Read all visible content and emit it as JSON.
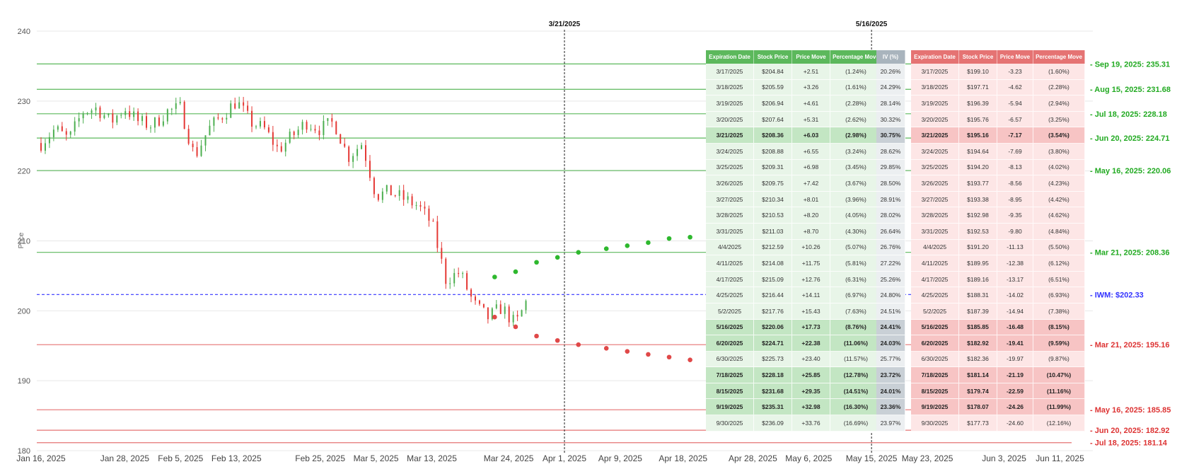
{
  "chart_data": {
    "type": "candlestick",
    "ylabel": "Price",
    "ylim": [
      180,
      240
    ],
    "yticks": [
      "180",
      "190",
      "200",
      "210",
      "220",
      "230",
      "240"
    ],
    "xlim": [
      "2025-01-16",
      "2025-06-15"
    ],
    "xticks": [
      {
        "date": "2025-01-16",
        "label": "Jan 16, 2025"
      },
      {
        "date": "2025-01-28",
        "label": "Jan 28, 2025"
      },
      {
        "date": "2025-02-05",
        "label": "Feb 5, 2025"
      },
      {
        "date": "2025-02-13",
        "label": "Feb 13, 2025"
      },
      {
        "date": "2025-02-25",
        "label": "Feb 25, 2025"
      },
      {
        "date": "2025-03-05",
        "label": "Mar 5, 2025"
      },
      {
        "date": "2025-03-13",
        "label": "Mar 13, 2025"
      },
      {
        "date": "2025-03-24",
        "label": "Mar 24, 2025"
      },
      {
        "date": "2025-04-01",
        "label": "Apr 1, 2025"
      },
      {
        "date": "2025-04-09",
        "label": "Apr 9, 2025"
      },
      {
        "date": "2025-04-18",
        "label": "Apr 18, 2025"
      },
      {
        "date": "2025-04-28",
        "label": "Apr 28, 2025"
      },
      {
        "date": "2025-05-06",
        "label": "May 6, 2025"
      },
      {
        "date": "2025-05-15",
        "label": "May 15, 2025"
      },
      {
        "date": "2025-05-23",
        "label": "May 23, 2025"
      },
      {
        "date": "2025-06-03",
        "label": "Jun 3, 2025"
      },
      {
        "date": "2025-06-11",
        "label": "Jun 11, 2025"
      }
    ],
    "price_path": [
      [
        "2025-01-16",
        224
      ],
      [
        "2025-01-18",
        226
      ],
      [
        "2025-01-20",
        224.5
      ],
      [
        "2025-01-22",
        228.5
      ],
      [
        "2025-01-24",
        229
      ],
      [
        "2025-01-26",
        227
      ],
      [
        "2025-01-28",
        229
      ],
      [
        "2025-01-30",
        227
      ],
      [
        "2025-02-01",
        226.5
      ],
      [
        "2025-02-03",
        228.5
      ],
      [
        "2025-02-05",
        229
      ],
      [
        "2025-02-07",
        222
      ],
      [
        "2025-02-09",
        226
      ],
      [
        "2025-02-11",
        228
      ],
      [
        "2025-02-13",
        230
      ],
      [
        "2025-02-15",
        227
      ],
      [
        "2025-02-17",
        226
      ],
      [
        "2025-02-19",
        223
      ],
      [
        "2025-02-21",
        225
      ],
      [
        "2025-02-23",
        227
      ],
      [
        "2025-02-25",
        226
      ],
      [
        "2025-02-27",
        227
      ],
      [
        "2025-03-01",
        222
      ],
      [
        "2025-03-03",
        224
      ],
      [
        "2025-03-05",
        216.5
      ],
      [
        "2025-03-07",
        217
      ],
      [
        "2025-03-09",
        216
      ],
      [
        "2025-03-11",
        215
      ],
      [
        "2025-03-13",
        212.5
      ],
      [
        "2025-03-15",
        204.5
      ],
      [
        "2025-03-17",
        205.5
      ],
      [
        "2025-03-19",
        201
      ],
      [
        "2025-03-21",
        199
      ],
      [
        "2025-03-23",
        200.5
      ],
      [
        "2025-03-25",
        198
      ],
      [
        "2025-03-27",
        202.3
      ]
    ],
    "current_price": {
      "label": "IWM: $202.33",
      "value": 202.33,
      "color": "#3333ff"
    },
    "upper_levels": [
      {
        "label": "Sep 19, 2025: 235.31",
        "value": 235.31
      },
      {
        "label": "Aug 15, 2025: 231.68",
        "value": 231.68
      },
      {
        "label": "Jul 18, 2025: 228.18",
        "value": 228.18
      },
      {
        "label": "Jun 20, 2025: 224.71",
        "value": 224.71
      },
      {
        "label": "May 16, 2025: 220.06",
        "value": 220.06
      },
      {
        "label": "Mar 21, 2025: 208.36",
        "value": 208.36
      }
    ],
    "lower_levels": [
      {
        "label": "Mar 21, 2025: 195.16",
        "value": 195.16
      },
      {
        "label": "May 16, 2025: 185.85",
        "value": 185.85
      },
      {
        "label": "Jun 20, 2025: 182.92",
        "value": 182.92
      },
      {
        "label": "Jul 18, 2025: 181.14",
        "value": 181.14
      }
    ],
    "level_colors": {
      "upper": "#22aa22",
      "lower": "#dd3333",
      "up_line": "#5cb85c",
      "down_line": "#e57373"
    },
    "vertical_markers": [
      {
        "date": "2025-04-01",
        "label": "3/21/2025"
      },
      {
        "date": "2025-05-15",
        "label": "5/16/2025"
      }
    ],
    "upper_projection": [
      [
        "2025-03-22",
        204.84
      ],
      [
        "2025-03-25",
        205.59
      ],
      [
        "2025-03-28",
        206.94
      ],
      [
        "2025-03-31",
        207.64
      ],
      [
        "2025-04-03",
        208.36
      ],
      [
        "2025-04-07",
        208.88
      ],
      [
        "2025-04-10",
        209.31
      ],
      [
        "2025-04-13",
        209.75
      ],
      [
        "2025-04-16",
        210.34
      ],
      [
        "2025-04-19",
        210.53
      ],
      [
        "2025-04-22",
        211.03
      ],
      [
        "2025-05-01",
        212.59
      ],
      [
        "2025-05-11",
        214.08
      ],
      [
        "2025-05-19",
        215.09
      ]
    ],
    "lower_projection": [
      [
        "2025-03-22",
        199.1
      ],
      [
        "2025-03-25",
        197.71
      ],
      [
        "2025-03-28",
        196.39
      ],
      [
        "2025-03-31",
        195.76
      ],
      [
        "2025-04-03",
        195.16
      ],
      [
        "2025-04-07",
        194.64
      ],
      [
        "2025-04-10",
        194.2
      ],
      [
        "2025-04-13",
        193.77
      ],
      [
        "2025-04-16",
        193.38
      ],
      [
        "2025-04-19",
        192.98
      ],
      [
        "2025-04-22",
        192.53
      ],
      [
        "2025-05-01",
        191.2
      ],
      [
        "2025-05-11",
        189.95
      ],
      [
        "2025-05-19",
        189.16
      ]
    ]
  },
  "tables": {
    "green_headers": [
      "Expiration Date",
      "Stock Price",
      "Price Move",
      "Percentage Move"
    ],
    "iv_header": "IV (%)",
    "red_headers": [
      "Expiration Date",
      "Stock Price",
      "Price Move",
      "Percentage Move"
    ],
    "rows": [
      {
        "date": "3/17/2025",
        "up_price": "$204.84",
        "up_move": "+2.51",
        "up_pct": "(1.24%)",
        "iv": "20.26%",
        "dn_price": "$199.10",
        "dn_move": "-3.23",
        "dn_pct": "(1.60%)",
        "hl": false
      },
      {
        "date": "3/18/2025",
        "up_price": "$205.59",
        "up_move": "+3.26",
        "up_pct": "(1.61%)",
        "iv": "24.29%",
        "dn_price": "$197.71",
        "dn_move": "-4.62",
        "dn_pct": "(2.28%)",
        "hl": false
      },
      {
        "date": "3/19/2025",
        "up_price": "$206.94",
        "up_move": "+4.61",
        "up_pct": "(2.28%)",
        "iv": "28.14%",
        "dn_price": "$196.39",
        "dn_move": "-5.94",
        "dn_pct": "(2.94%)",
        "hl": false
      },
      {
        "date": "3/20/2025",
        "up_price": "$207.64",
        "up_move": "+5.31",
        "up_pct": "(2.62%)",
        "iv": "30.32%",
        "dn_price": "$195.76",
        "dn_move": "-6.57",
        "dn_pct": "(3.25%)",
        "hl": false
      },
      {
        "date": "3/21/2025",
        "up_price": "$208.36",
        "up_move": "+6.03",
        "up_pct": "(2.98%)",
        "iv": "30.75%",
        "dn_price": "$195.16",
        "dn_move": "-7.17",
        "dn_pct": "(3.54%)",
        "hl": true
      },
      {
        "date": "3/24/2025",
        "up_price": "$208.88",
        "up_move": "+6.55",
        "up_pct": "(3.24%)",
        "iv": "28.62%",
        "dn_price": "$194.64",
        "dn_move": "-7.69",
        "dn_pct": "(3.80%)",
        "hl": false
      },
      {
        "date": "3/25/2025",
        "up_price": "$209.31",
        "up_move": "+6.98",
        "up_pct": "(3.45%)",
        "iv": "29.85%",
        "dn_price": "$194.20",
        "dn_move": "-8.13",
        "dn_pct": "(4.02%)",
        "hl": false
      },
      {
        "date": "3/26/2025",
        "up_price": "$209.75",
        "up_move": "+7.42",
        "up_pct": "(3.67%)",
        "iv": "28.50%",
        "dn_price": "$193.77",
        "dn_move": "-8.56",
        "dn_pct": "(4.23%)",
        "hl": false
      },
      {
        "date": "3/27/2025",
        "up_price": "$210.34",
        "up_move": "+8.01",
        "up_pct": "(3.96%)",
        "iv": "28.91%",
        "dn_price": "$193.38",
        "dn_move": "-8.95",
        "dn_pct": "(4.42%)",
        "hl": false
      },
      {
        "date": "3/28/2025",
        "up_price": "$210.53",
        "up_move": "+8.20",
        "up_pct": "(4.05%)",
        "iv": "28.02%",
        "dn_price": "$192.98",
        "dn_move": "-9.35",
        "dn_pct": "(4.62%)",
        "hl": false
      },
      {
        "date": "3/31/2025",
        "up_price": "$211.03",
        "up_move": "+8.70",
        "up_pct": "(4.30%)",
        "iv": "26.64%",
        "dn_price": "$192.53",
        "dn_move": "-9.80",
        "dn_pct": "(4.84%)",
        "hl": false
      },
      {
        "date": "4/4/2025",
        "up_price": "$212.59",
        "up_move": "+10.26",
        "up_pct": "(5.07%)",
        "iv": "26.76%",
        "dn_price": "$191.20",
        "dn_move": "-11.13",
        "dn_pct": "(5.50%)",
        "hl": false
      },
      {
        "date": "4/11/2025",
        "up_price": "$214.08",
        "up_move": "+11.75",
        "up_pct": "(5.81%)",
        "iv": "27.22%",
        "dn_price": "$189.95",
        "dn_move": "-12.38",
        "dn_pct": "(6.12%)",
        "hl": false
      },
      {
        "date": "4/17/2025",
        "up_price": "$215.09",
        "up_move": "+12.76",
        "up_pct": "(6.31%)",
        "iv": "25.26%",
        "dn_price": "$189.16",
        "dn_move": "-13.17",
        "dn_pct": "(6.51%)",
        "hl": false
      },
      {
        "date": "4/25/2025",
        "up_price": "$216.44",
        "up_move": "+14.11",
        "up_pct": "(6.97%)",
        "iv": "24.80%",
        "dn_price": "$188.31",
        "dn_move": "-14.02",
        "dn_pct": "(6.93%)",
        "hl": false
      },
      {
        "date": "5/2/2025",
        "up_price": "$217.76",
        "up_move": "+15.43",
        "up_pct": "(7.63%)",
        "iv": "24.51%",
        "dn_price": "$187.39",
        "dn_move": "-14.94",
        "dn_pct": "(7.38%)",
        "hl": false
      },
      {
        "date": "5/16/2025",
        "up_price": "$220.06",
        "up_move": "+17.73",
        "up_pct": "(8.76%)",
        "iv": "24.41%",
        "dn_price": "$185.85",
        "dn_move": "-16.48",
        "dn_pct": "(8.15%)",
        "hl": true
      },
      {
        "date": "6/20/2025",
        "up_price": "$224.71",
        "up_move": "+22.38",
        "up_pct": "(11.06%)",
        "iv": "24.03%",
        "dn_price": "$182.92",
        "dn_move": "-19.41",
        "dn_pct": "(9.59%)",
        "hl": true
      },
      {
        "date": "6/30/2025",
        "up_price": "$225.73",
        "up_move": "+23.40",
        "up_pct": "(11.57%)",
        "iv": "25.77%",
        "dn_price": "$182.36",
        "dn_move": "-19.97",
        "dn_pct": "(9.87%)",
        "hl": false
      },
      {
        "date": "7/18/2025",
        "up_price": "$228.18",
        "up_move": "+25.85",
        "up_pct": "(12.78%)",
        "iv": "23.72%",
        "dn_price": "$181.14",
        "dn_move": "-21.19",
        "dn_pct": "(10.47%)",
        "hl": true
      },
      {
        "date": "8/15/2025",
        "up_price": "$231.68",
        "up_move": "+29.35",
        "up_pct": "(14.51%)",
        "iv": "24.01%",
        "dn_price": "$179.74",
        "dn_move": "-22.59",
        "dn_pct": "(11.16%)",
        "hl": true
      },
      {
        "date": "9/19/2025",
        "up_price": "$235.31",
        "up_move": "+32.98",
        "up_pct": "(16.30%)",
        "iv": "23.36%",
        "dn_price": "$178.07",
        "dn_move": "-24.26",
        "dn_pct": "(11.99%)",
        "hl": true
      },
      {
        "date": "9/30/2025",
        "up_price": "$236.09",
        "up_move": "+33.76",
        "up_pct": "(16.69%)",
        "iv": "23.97%",
        "dn_price": "$177.73",
        "dn_move": "-24.60",
        "dn_pct": "(12.16%)",
        "hl": false
      }
    ]
  }
}
